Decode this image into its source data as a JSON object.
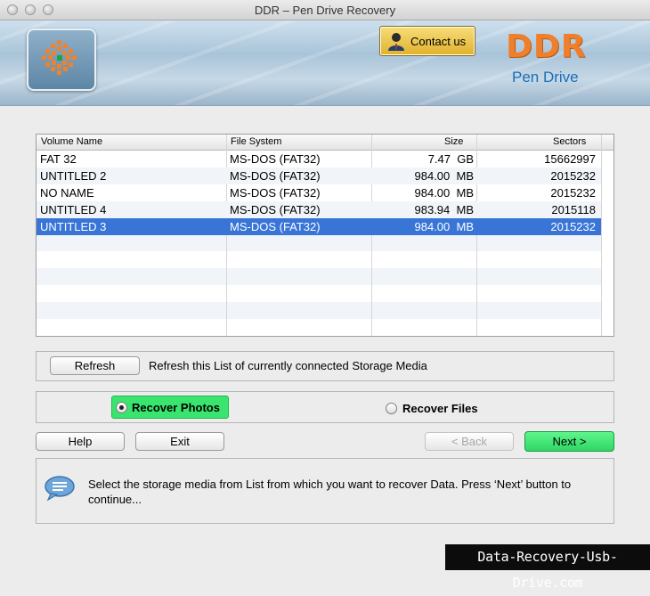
{
  "window": {
    "title": "DDR – Pen Drive Recovery"
  },
  "header": {
    "contact_label": "Contact us",
    "brand": "DDR",
    "subtitle": "Pen Drive",
    "brand_color": "#f07f2b",
    "subtitle_color": "#1b6fb5"
  },
  "table": {
    "columns": [
      "Volume Name",
      "File System",
      "Size",
      "Sectors"
    ],
    "rows": [
      {
        "name": "FAT 32",
        "fs": "MS-DOS (FAT32)",
        "size": "7.47  GB",
        "sectors": "15662997"
      },
      {
        "name": "UNTITLED 2",
        "fs": "MS-DOS (FAT32)",
        "size": "984.00  MB",
        "sectors": "2015232"
      },
      {
        "name": "NO NAME",
        "fs": "MS-DOS (FAT32)",
        "size": "984.00  MB",
        "sectors": "2015232"
      },
      {
        "name": "UNTITLED 4",
        "fs": "MS-DOS (FAT32)",
        "size": "983.94  MB",
        "sectors": "2015118"
      },
      {
        "name": "UNTITLED 3",
        "fs": "MS-DOS (FAT32)",
        "size": "984.00  MB",
        "sectors": "2015232"
      }
    ],
    "selected_row": "UNTITLED 3",
    "selection_color": "#3875d7"
  },
  "refresh": {
    "button_label": "Refresh",
    "description": "Refresh this List of currently connected Storage Media"
  },
  "mode": {
    "photos_label": "Recover Photos",
    "files_label": "Recover Files",
    "selected": "Recover Photos",
    "highlight_color": "#39e56e"
  },
  "buttons": {
    "help": "Help",
    "exit": "Exit",
    "back": "< Back",
    "next": "Next >"
  },
  "info": {
    "message": "Select the storage media from List from which you want to recover Data. Press ‘Next’ button to continue..."
  },
  "watermark": "Data-Recovery-Usb-Drive.com"
}
